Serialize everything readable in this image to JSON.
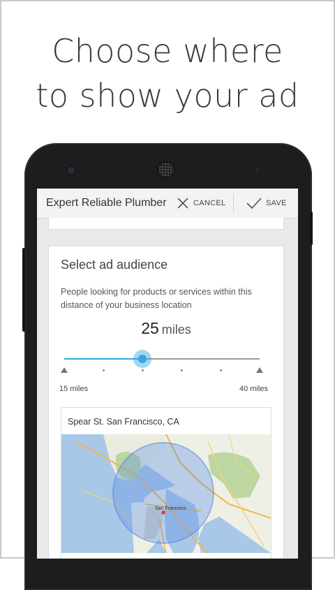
{
  "headline": {
    "line1": "Choose where",
    "line2": "to show your ad"
  },
  "action_bar": {
    "title": "Expert Reliable Plumber",
    "cancel_label": "CANCEL",
    "save_label": "SAVE"
  },
  "audience_card": {
    "title": "Select ad audience",
    "description": "People looking for products or services within this distance of your business location",
    "distance_value": "25",
    "distance_unit": "miles",
    "slider": {
      "min": 15,
      "max": 40,
      "value": 25
    },
    "min_label": "15 miles",
    "max_label": "40 miles"
  },
  "map": {
    "address": "Spear St. San Francisco, CA",
    "city_label": "San Francisco"
  },
  "colors": {
    "accent": "#33a6dd",
    "headline": "#3a3a3a"
  }
}
